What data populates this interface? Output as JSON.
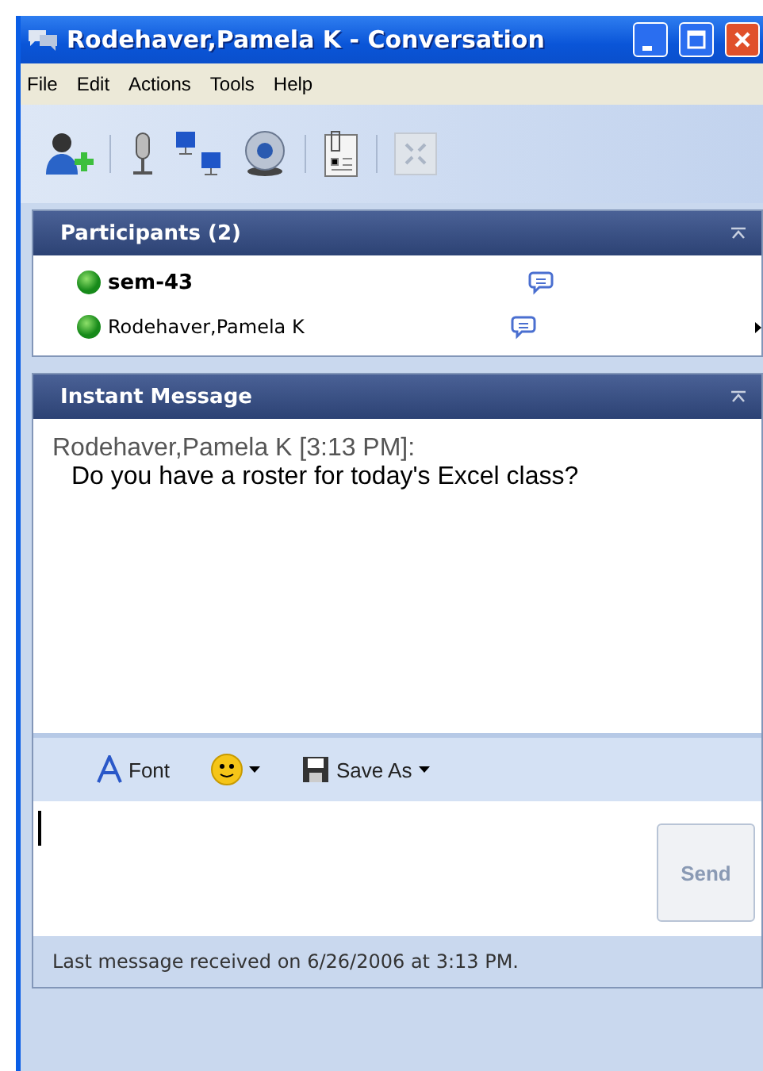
{
  "window": {
    "title": "Rodehaver,Pamela K - Conversation"
  },
  "menu": [
    "File",
    "Edit",
    "Actions",
    "Tools",
    "Help"
  ],
  "participants": {
    "title": "Participants (2)",
    "items": [
      {
        "name": "sem-43",
        "self": true,
        "has_arrow": false
      },
      {
        "name": "Rodehaver,Pamela K",
        "self": false,
        "has_arrow": true
      }
    ]
  },
  "instant_message": {
    "title": "Instant Message",
    "messages": [
      {
        "sender": "Rodehaver,Pamela K [3:13 PM]:",
        "text": "Do you have a roster for today's Excel class?"
      }
    ]
  },
  "format_toolbar": {
    "font": "Font",
    "save_as": "Save As"
  },
  "send_button": {
    "label": "Send",
    "disabled": true
  },
  "status": "Last message received on 6/26/2006 at 3:13 PM."
}
